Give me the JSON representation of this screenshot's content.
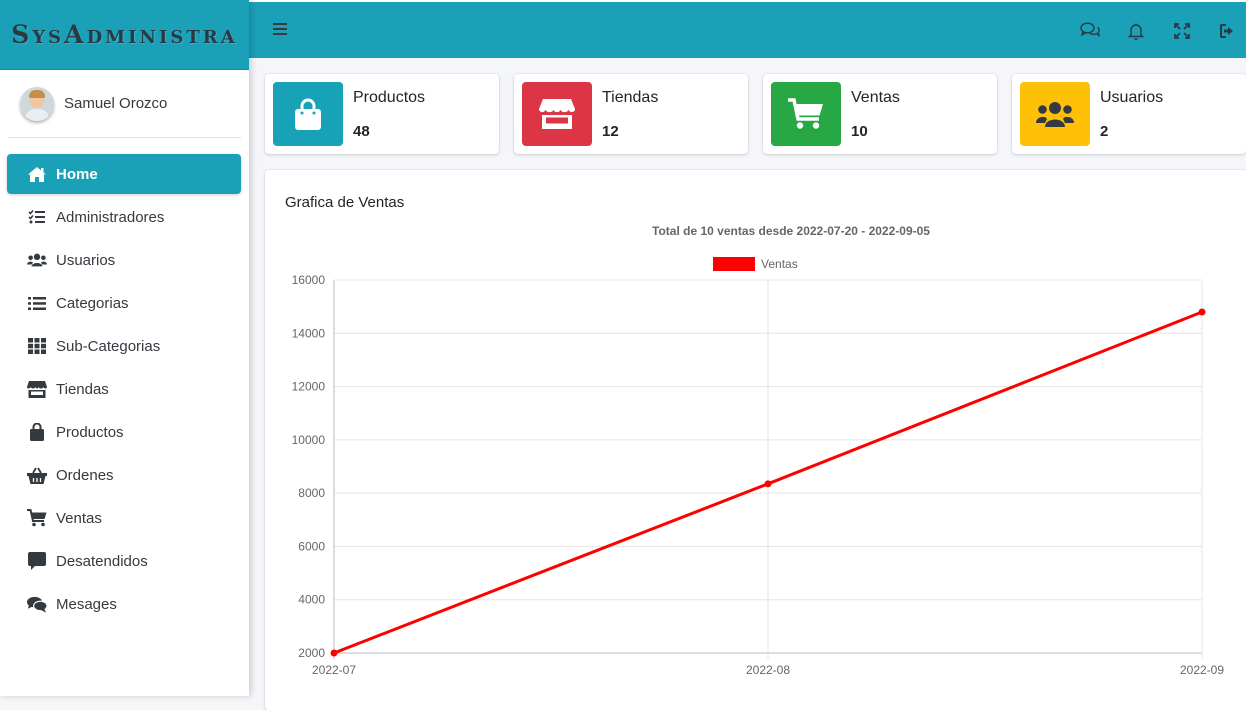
{
  "brand": {
    "name": "SysAdministra"
  },
  "user": {
    "name": "Samuel Orozco"
  },
  "sidebar": {
    "items": [
      {
        "label": "Home",
        "icon": "home-icon",
        "active": true
      },
      {
        "label": "Administradores",
        "icon": "tasks-icon"
      },
      {
        "label": "Usuarios",
        "icon": "users-icon"
      },
      {
        "label": "Categorias",
        "icon": "list-icon"
      },
      {
        "label": "Sub-Categorias",
        "icon": "grid-icon"
      },
      {
        "label": "Tiendas",
        "icon": "store-icon"
      },
      {
        "label": "Productos",
        "icon": "shopping-bag-icon"
      },
      {
        "label": "Ordenes",
        "icon": "basket-icon"
      },
      {
        "label": "Ventas",
        "icon": "cart-icon"
      },
      {
        "label": "Desatendidos",
        "icon": "comment-icon"
      },
      {
        "label": "Mesages",
        "icon": "comments-icon"
      }
    ]
  },
  "topbar": {
    "icons": [
      "menu-icon",
      "chat-icon",
      "bell-icon",
      "expand-icon",
      "logout-icon"
    ]
  },
  "stats": [
    {
      "label": "Productos",
      "value": "48",
      "color": "#17a2b8",
      "icon": "shopping-bag-icon"
    },
    {
      "label": "Tiendas",
      "value": "12",
      "color": "#dc3545",
      "icon": "store-icon"
    },
    {
      "label": "Ventas",
      "value": "10",
      "color": "#28a745",
      "icon": "cart-icon"
    },
    {
      "label": "Usuarios",
      "value": "2",
      "color": "#ffc107",
      "icon": "users-icon"
    }
  ],
  "card": {
    "title": "Grafica de Ventas"
  },
  "chart_data": {
    "type": "line",
    "title": "Total de 10 ventas desde 2022-07-20 - 2022-09-05",
    "x": [
      "2022-07",
      "2022-08",
      "2022-09"
    ],
    "series": [
      {
        "name": "Ventas",
        "values": [
          2000,
          8350,
          14800
        ],
        "color": "#ff0000"
      }
    ],
    "ylim": [
      2000,
      16000
    ],
    "yticks": [
      2000,
      4000,
      6000,
      8000,
      10000,
      12000,
      14000,
      16000
    ],
    "grid": true,
    "legend": "top-center"
  }
}
